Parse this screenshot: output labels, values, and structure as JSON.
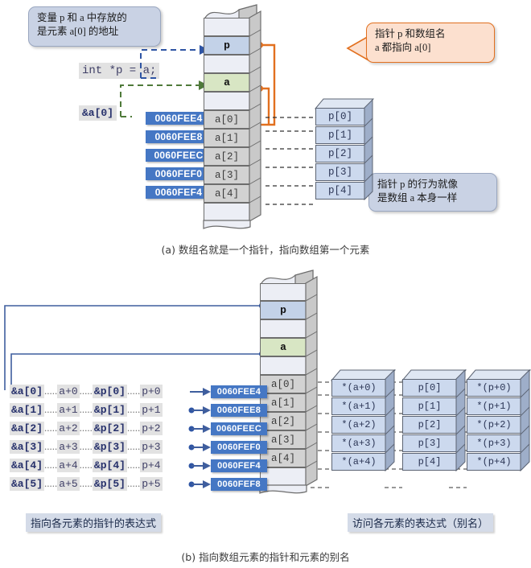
{
  "panel_a": {
    "note_blue": "变量 p 和 a 中存放的\n是元素 a[0] 的地址",
    "code": "int *p = a;",
    "addr_label": "&a[0]",
    "note_orange": "指针 p 和数组名\na 都指向 a[0]",
    "note_gray": "指针 p 的行为就像\n是数组 a 本身一样",
    "addresses": [
      "0060FEE4",
      "0060FEE8",
      "0060FEEC",
      "0060FEF0",
      "0060FEF4"
    ],
    "stack_cells": [
      "",
      "p",
      "",
      "a",
      "",
      "a[0]",
      "a[1]",
      "a[2]",
      "a[3]",
      "a[4]",
      ""
    ],
    "p_boxes": [
      "p[0]",
      "p[1]",
      "p[2]",
      "p[3]",
      "p[4]"
    ],
    "caption": "(a) 数组名就是一个指针，指向数组第一个元素"
  },
  "panel_b": {
    "rows": [
      {
        "amp_a": "&a[0]",
        "a_plus": "a+0",
        "amp_p": "&p[0]",
        "p_plus": "p+0",
        "addr": "0060FEE4"
      },
      {
        "amp_a": "&a[1]",
        "a_plus": "a+1",
        "amp_p": "&p[1]",
        "p_plus": "p+1",
        "addr": "0060FEE8"
      },
      {
        "amp_a": "&a[2]",
        "a_plus": "a+2",
        "amp_p": "&p[2]",
        "p_plus": "p+2",
        "addr": "0060FEEC"
      },
      {
        "amp_a": "&a[3]",
        "a_plus": "a+3",
        "amp_p": "&p[3]",
        "p_plus": "p+3",
        "addr": "0060FEF0"
      },
      {
        "amp_a": "&a[4]",
        "a_plus": "a+4",
        "amp_p": "&p[4]",
        "p_plus": "p+4",
        "addr": "0060FEF4"
      },
      {
        "amp_a": "&a[5]",
        "a_plus": "a+5",
        "amp_p": "&p[5]",
        "p_plus": "p+5",
        "addr": "0060FEF8"
      }
    ],
    "stack_cells": [
      "",
      "p",
      "",
      "a",
      "",
      "a[0]",
      "a[1]",
      "a[2]",
      "a[3]",
      "a[4]",
      ""
    ],
    "col_star_a": [
      "*(a+0)",
      "*(a+1)",
      "*(a+2)",
      "*(a+3)",
      "*(a+4)"
    ],
    "col_p": [
      "p[0]",
      "p[1]",
      "p[2]",
      "p[3]",
      "p[4]"
    ],
    "col_star_p": [
      "*(p+0)",
      "*(p+1)",
      "*(p+2)",
      "*(p+3)",
      "*(p+4)"
    ],
    "label_left": "指向各元素的指针的表达式",
    "label_right": "访问各元素的表达式（别名）",
    "caption": "(b) 指向数组元素的指针和元素的别名"
  },
  "colors": {
    "addr_pill": "#4577c4",
    "cell_p": "#c3d2e8",
    "cell_a": "#d8e6c4",
    "accent_orange": "#e2701f",
    "accent_blue": "#2f55a4",
    "accent_green": "#4f7a3a"
  }
}
